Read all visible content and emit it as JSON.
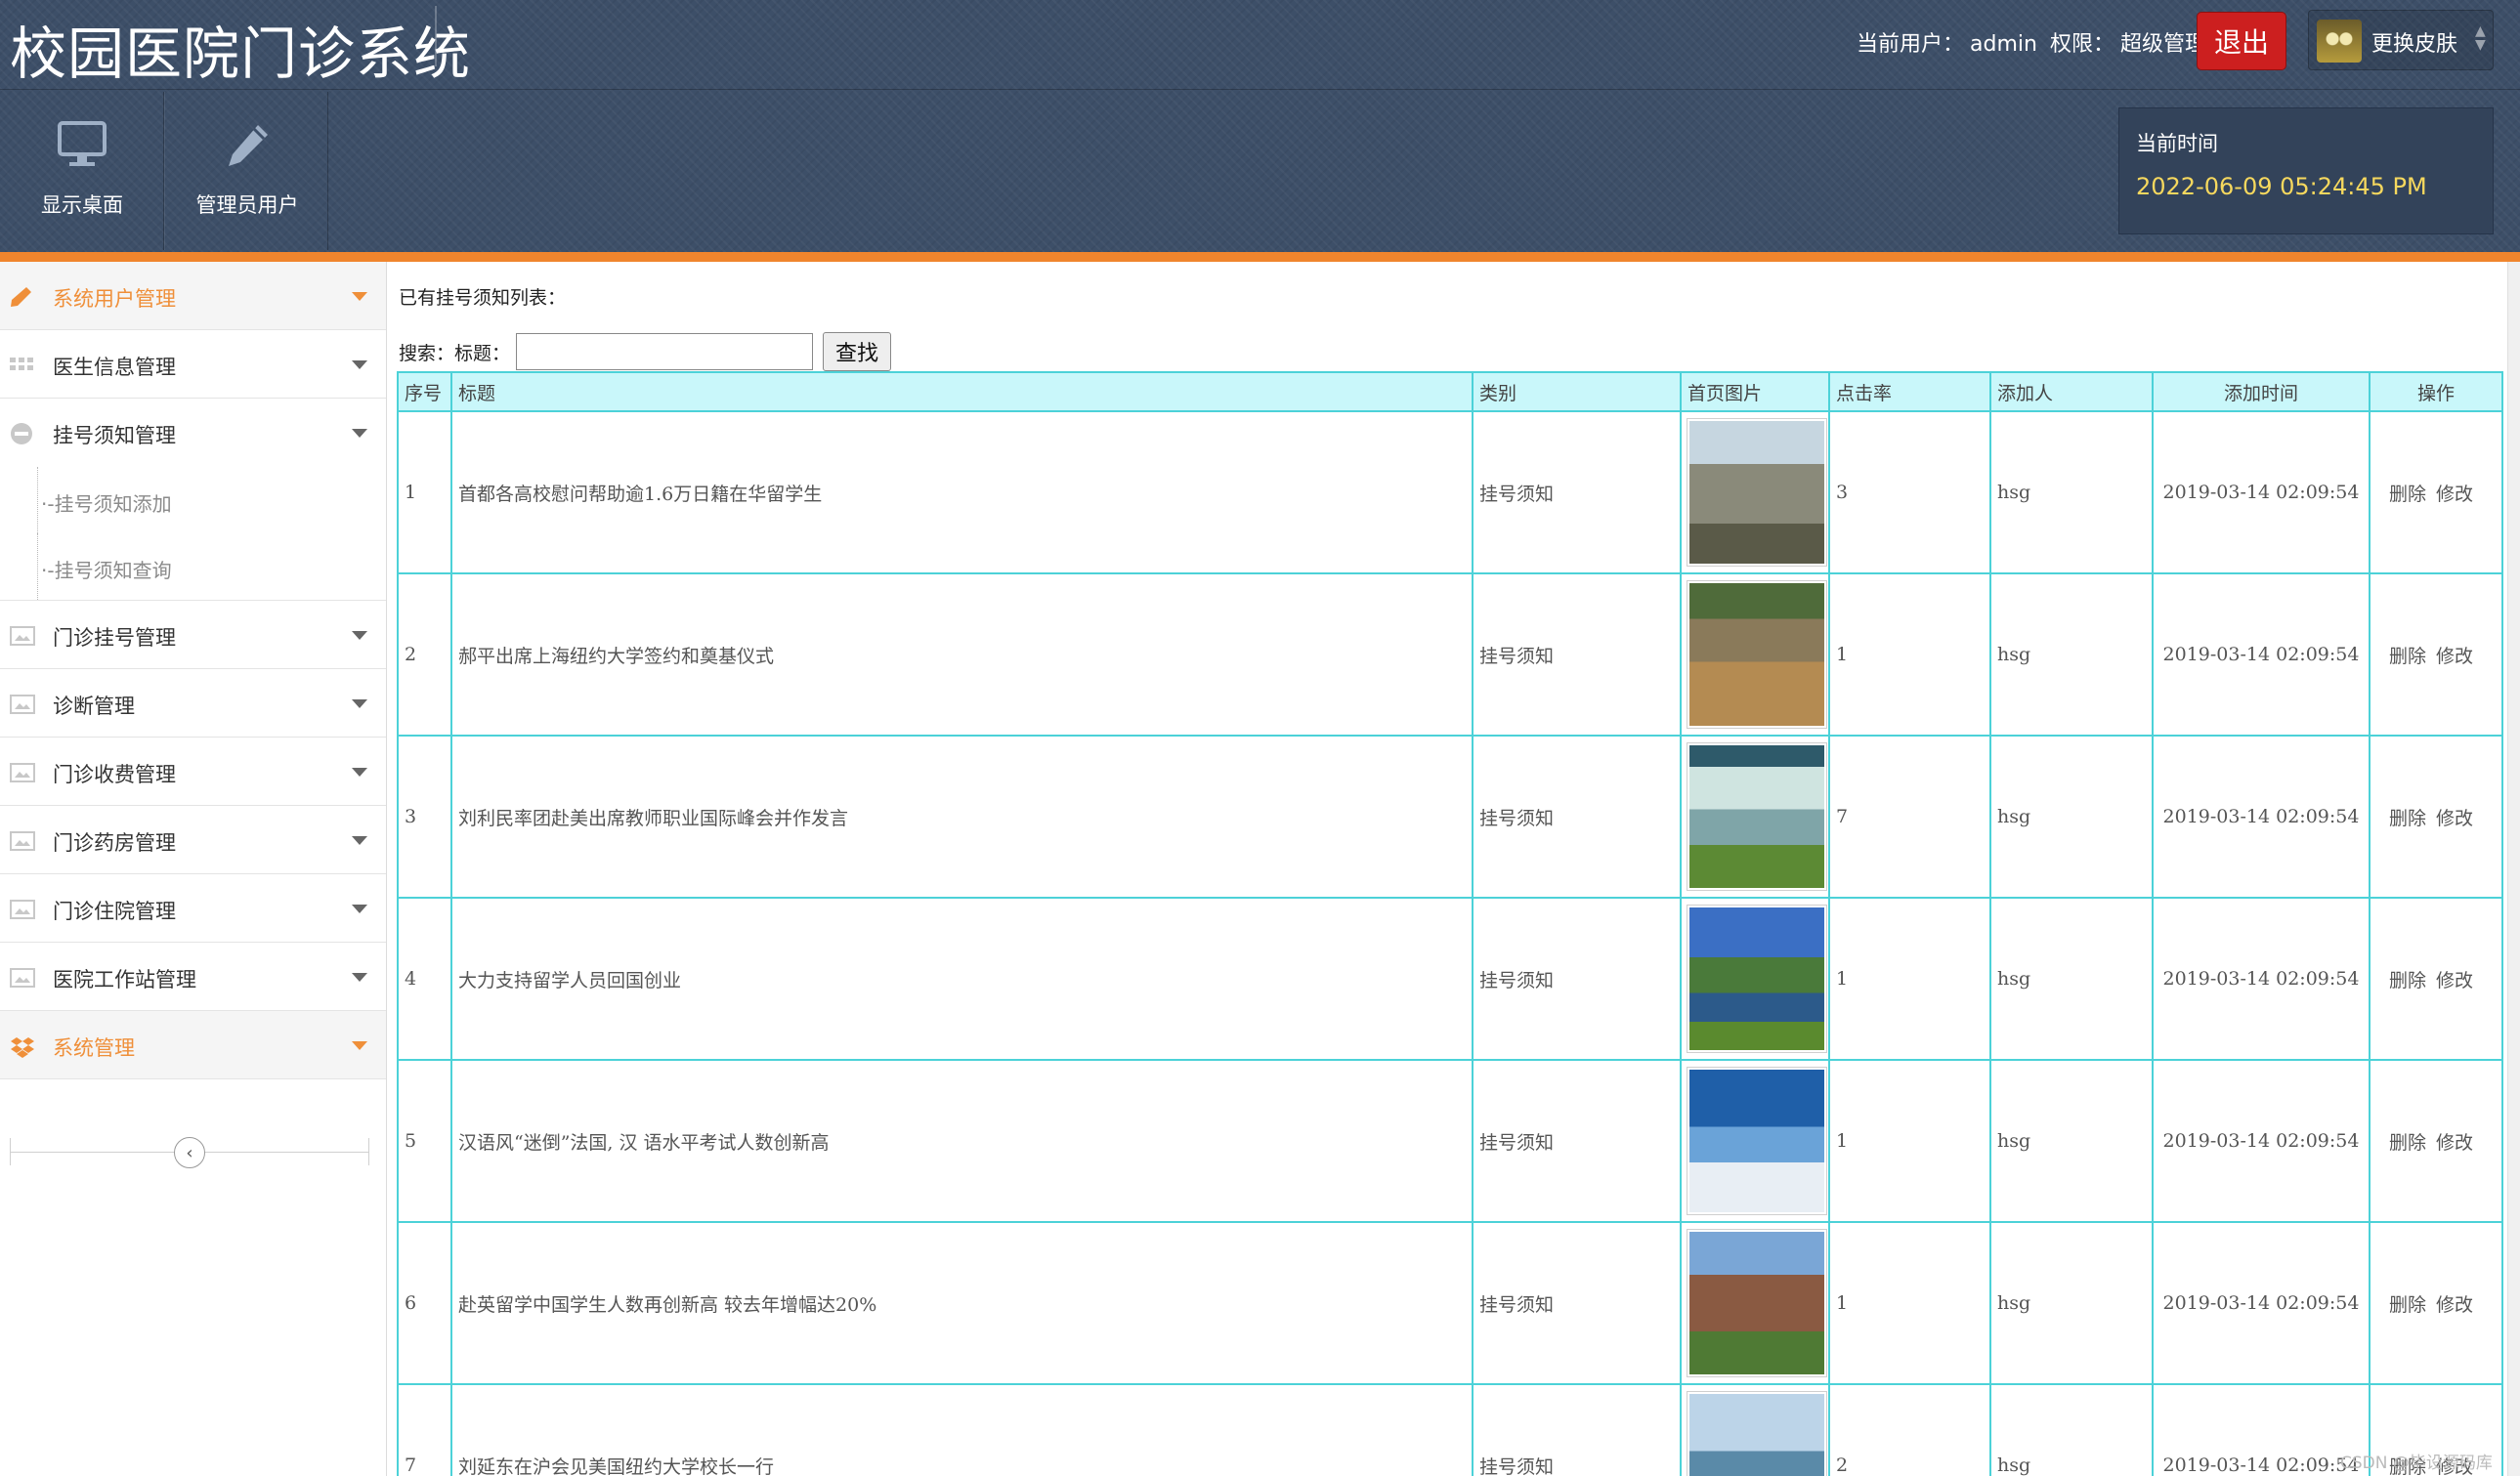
{
  "app": {
    "title": "校园医院门诊系统",
    "user_prefix": "当前用户：",
    "user": "admin",
    "role_prefix": "权限：",
    "role": "超级管理员",
    "logout": "退出",
    "skin": "更换皮肤"
  },
  "toolbar": {
    "desktop": "显示桌面",
    "admin_user": "管理员用户"
  },
  "clock": {
    "label": "当前时间",
    "value": "2022-06-09 05:24:45 PM"
  },
  "sidebar": {
    "items": [
      {
        "label": "系统用户管理",
        "icon": "pencil-icon",
        "state": "active"
      },
      {
        "label": "医生信息管理",
        "icon": "grid-icon"
      },
      {
        "label": "挂号须知管理",
        "icon": "minus-circle-icon"
      },
      {
        "label": "门诊挂号管理",
        "icon": "image-icon"
      },
      {
        "label": "诊断管理",
        "icon": "image-icon"
      },
      {
        "label": "门诊收费管理",
        "icon": "image-icon"
      },
      {
        "label": "门诊药房管理",
        "icon": "image-icon"
      },
      {
        "label": "门诊住院管理",
        "icon": "image-icon"
      },
      {
        "label": "医院工作站管理",
        "icon": "image-icon"
      },
      {
        "label": "系统管理",
        "icon": "dropbox-icon",
        "state": "accent"
      }
    ],
    "sub_items": [
      {
        "label": "挂号须知添加"
      },
      {
        "label": "挂号须知查询"
      }
    ],
    "sub_prefix": "·-"
  },
  "main": {
    "list_title": "已有挂号须知列表：",
    "search_label": "搜索：",
    "search_field_label": "标题：",
    "search_value": "",
    "search_button": "查找",
    "columns": [
      "序号",
      "标题",
      "类别",
      "首页图片",
      "点击率",
      "添加人",
      "添加时间",
      "操作"
    ],
    "rows": [
      {
        "no": "1",
        "title": "首都各高校慰问帮助逾1.6万日籍在华留学生",
        "category": "挂号须知",
        "clicks": "3",
        "author": "hsg",
        "time": "2019-03-14 02:09:54",
        "del": "删除",
        "edit": "修改"
      },
      {
        "no": "2",
        "title": "郝平出席上海纽约大学签约和奠基仪式",
        "category": "挂号须知",
        "clicks": "1",
        "author": "hsg",
        "time": "2019-03-14 02:09:54",
        "del": "删除",
        "edit": "修改"
      },
      {
        "no": "3",
        "title": "刘利民率团赴美出席教师职业国际峰会并作发言",
        "category": "挂号须知",
        "clicks": "7",
        "author": "hsg",
        "time": "2019-03-14 02:09:54",
        "del": "删除",
        "edit": "修改"
      },
      {
        "no": "4",
        "title": "大力支持留学人员回国创业",
        "category": "挂号须知",
        "clicks": "1",
        "author": "hsg",
        "time": "2019-03-14 02:09:54",
        "del": "删除",
        "edit": "修改"
      },
      {
        "no": "5",
        "title": "汉语风“迷倒”法国, 汉 语水平考试人数创新高",
        "category": "挂号须知",
        "clicks": "1",
        "author": "hsg",
        "time": "2019-03-14 02:09:54",
        "del": "删除",
        "edit": "修改"
      },
      {
        "no": "6",
        "title": "赴英留学中国学生人数再创新高 较去年增幅达20%",
        "category": "挂号须知",
        "clicks": "1",
        "author": "hsg",
        "time": "2019-03-14 02:09:54",
        "del": "删除",
        "edit": "修改"
      },
      {
        "no": "7",
        "title": "刘延东在沪会见美国纽约大学校长一行",
        "category": "挂号须知",
        "clicks": "2",
        "author": "hsg",
        "time": "2019-03-14 02:09:54",
        "del": "删除",
        "edit": "修改"
      }
    ]
  },
  "watermark": "CSDN @毕设源码库",
  "colors": {
    "header_bg": "#3d4f68",
    "accent_orange": "#f0852d",
    "logout_red": "#cc1f1f",
    "time_yellow": "#f6d85e",
    "table_border": "#4cd2d8",
    "table_header_bg": "#c9f7fa"
  }
}
